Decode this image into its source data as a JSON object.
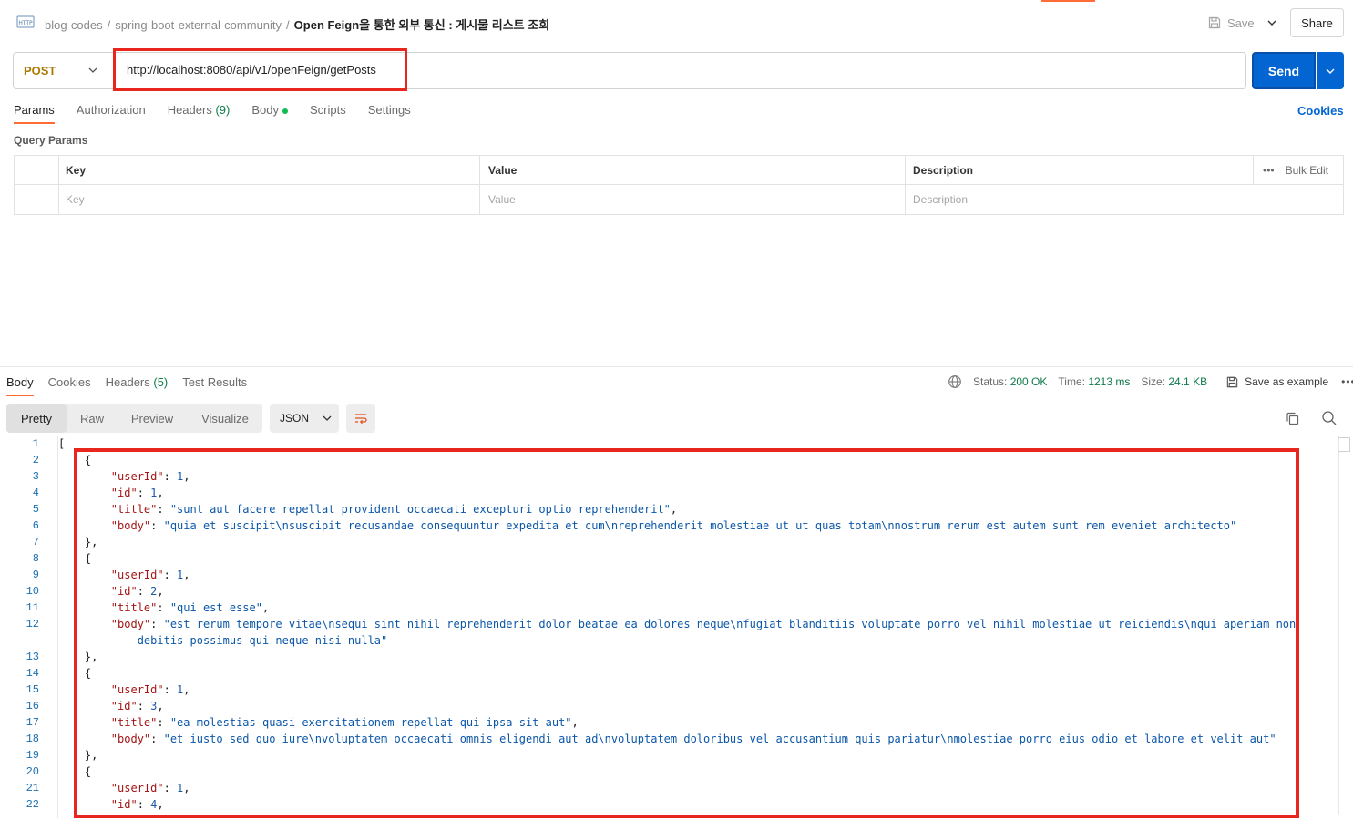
{
  "breadcrumb": {
    "workspace": "blog-codes",
    "collection": "spring-boot-external-community",
    "request": "Open Feign을 통한 외부 통신 : 게시물 리스트 조회"
  },
  "header": {
    "save_label": "Save",
    "share_label": "Share"
  },
  "request": {
    "method": "POST",
    "url": "http://localhost:8080/api/v1/openFeign/getPosts",
    "send_label": "Send"
  },
  "request_tabs": {
    "params": "Params",
    "authorization": "Authorization",
    "headers": "Headers",
    "headers_count": "(9)",
    "body": "Body",
    "scripts": "Scripts",
    "settings": "Settings",
    "cookies": "Cookies"
  },
  "query_params": {
    "title": "Query Params",
    "columns": {
      "key": "Key",
      "value": "Value",
      "description": "Description"
    },
    "bulk_edit": "Bulk Edit",
    "placeholders": {
      "key": "Key",
      "value": "Value",
      "description": "Description"
    }
  },
  "response_tabs": {
    "body": "Body",
    "cookies": "Cookies",
    "headers": "Headers",
    "headers_count": "(5)",
    "test_results": "Test Results"
  },
  "response_status": {
    "status_label": "Status:",
    "status_value": "200 OK",
    "time_label": "Time:",
    "time_value": "1213 ms",
    "size_label": "Size:",
    "size_value": "24.1 KB",
    "save_as_example": "Save as example"
  },
  "view_modes": {
    "pretty": "Pretty",
    "raw": "Raw",
    "preview": "Preview",
    "visualize": "Visualize",
    "format": "JSON"
  },
  "code": {
    "line_numbers": [
      "1",
      "2",
      "3",
      "4",
      "5",
      "6",
      "7",
      "8",
      "9",
      "10",
      "11",
      "12",
      "13",
      "14",
      "15",
      "16",
      "17",
      "18",
      "19",
      "20",
      "21",
      "22"
    ],
    "k_userId": "\"userId\"",
    "k_id": "\"id\"",
    "k_title": "\"title\"",
    "k_body": "\"body\"",
    "v_userId_1": "1",
    "v_id_1": "1",
    "v_id_2": "2",
    "v_id_3": "3",
    "v_id_4": "4",
    "title_1": "\"sunt aut facere repellat provident occaecati excepturi optio reprehenderit\"",
    "body_1": "\"quia et suscipit\\nsuscipit recusandae consequuntur expedita et cum\\nreprehenderit molestiae ut ut quas totam\\nnostrum rerum est autem sunt rem eveniet architecto\"",
    "title_2": "\"qui est esse\"",
    "body_2a": "\"est rerum tempore vitae\\nsequi sint nihil reprehenderit dolor beatae ea dolores neque\\nfugiat blanditiis voluptate porro vel nihil molestiae ut reiciendis\\nqui aperiam non",
    "body_2b": "debitis possimus qui neque nisi nulla\"",
    "title_3": "\"ea molestias quasi exercitationem repellat qui ipsa sit aut\"",
    "body_3": "\"et iusto sed quo iure\\nvoluptatem occaecati omnis eligendi aut ad\\nvoluptatem doloribus vel accusantium quis pariatur\\nmolestiae porro eius odio et labore et velit aut\""
  },
  "colors": {
    "accent": "#ff6c37",
    "send": "#0265d2",
    "highlight": "#e8261e",
    "method_post": "#ad7a03",
    "status_ok": "#0f7b4a"
  }
}
